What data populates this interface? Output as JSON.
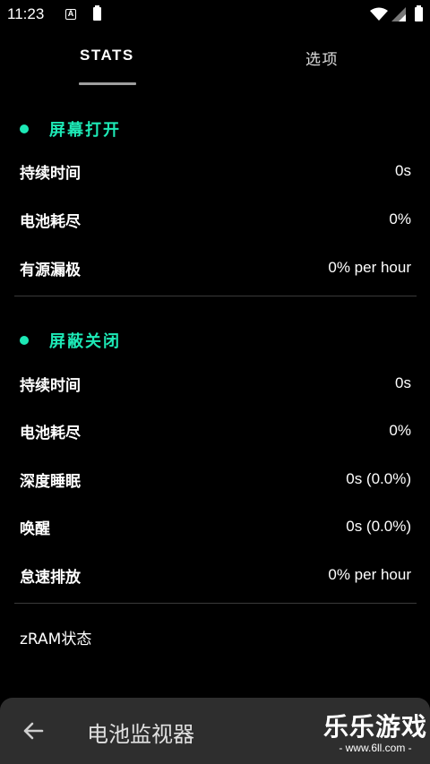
{
  "status_bar": {
    "time": "11:23",
    "notification_icon": "A",
    "icons": [
      "accessibility-icon",
      "battery-icon",
      "wifi-icon",
      "signal-icon",
      "battery-icon"
    ]
  },
  "tabs": {
    "stats": "STATS",
    "options": "选项",
    "active": "stats"
  },
  "screen_on": {
    "title": "屏幕打开",
    "rows": [
      {
        "label": "持续时间",
        "value": "0s"
      },
      {
        "label": "电池耗尽",
        "value": "0%"
      },
      {
        "label": "有源漏极",
        "value": "0% per hour"
      }
    ]
  },
  "screen_off": {
    "title": "屏蔽关闭",
    "rows": [
      {
        "label": "持续时间",
        "value": "0s"
      },
      {
        "label": "电池耗尽",
        "value": "0%"
      },
      {
        "label": "深度睡眠",
        "value": "0s (0.0%)"
      },
      {
        "label": "唤醒",
        "value": "0s (0.0%)"
      },
      {
        "label": "怠速排放",
        "value": "0% per hour"
      }
    ]
  },
  "zram": {
    "label": "zRAM状态"
  },
  "bottom_bar": {
    "back_icon": "arrow-left-icon",
    "title": "电池监视器"
  },
  "watermark": {
    "main": "乐乐游戏",
    "sub": "- www.6ll.com -"
  },
  "colors": {
    "background": "#000000",
    "accent": "#1de9b6",
    "text": "#ffffff",
    "divider": "#3a3a3a",
    "bottom_bar": "#2e2e2e"
  }
}
